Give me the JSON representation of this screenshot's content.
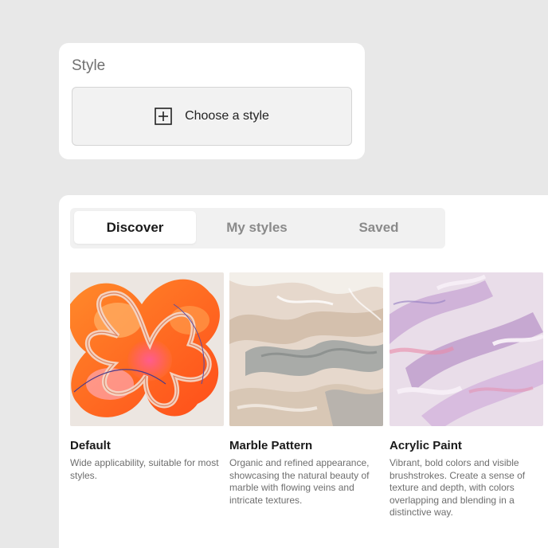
{
  "style_picker": {
    "title": "Style",
    "choose_label": "Choose a style"
  },
  "tabs": [
    {
      "label": "Discover",
      "active": true
    },
    {
      "label": "My styles",
      "active": false
    },
    {
      "label": "Saved",
      "active": false
    }
  ],
  "styles": [
    {
      "name": "Default",
      "description": "Wide applicability, suitable for most styles.",
      "thumbnail_icon": "abstract-orange-flower-thumbnail"
    },
    {
      "name": "Marble Pattern",
      "description": "Organic and refined appearance, showcasing the natural beauty of marble with flowing veins and intricate textures.",
      "thumbnail_icon": "marble-texture-thumbnail"
    },
    {
      "name": "Acrylic Paint",
      "description": "Vibrant, bold colors and visible brushstrokes. Create a sense of texture and depth, with colors overlapping and blending in a distinctive way.",
      "thumbnail_icon": "acrylic-brushstroke-thumbnail"
    }
  ],
  "colors": {
    "background": "#e8e8e8",
    "card": "#ffffff",
    "accent_orange": "#ff6a1a"
  }
}
